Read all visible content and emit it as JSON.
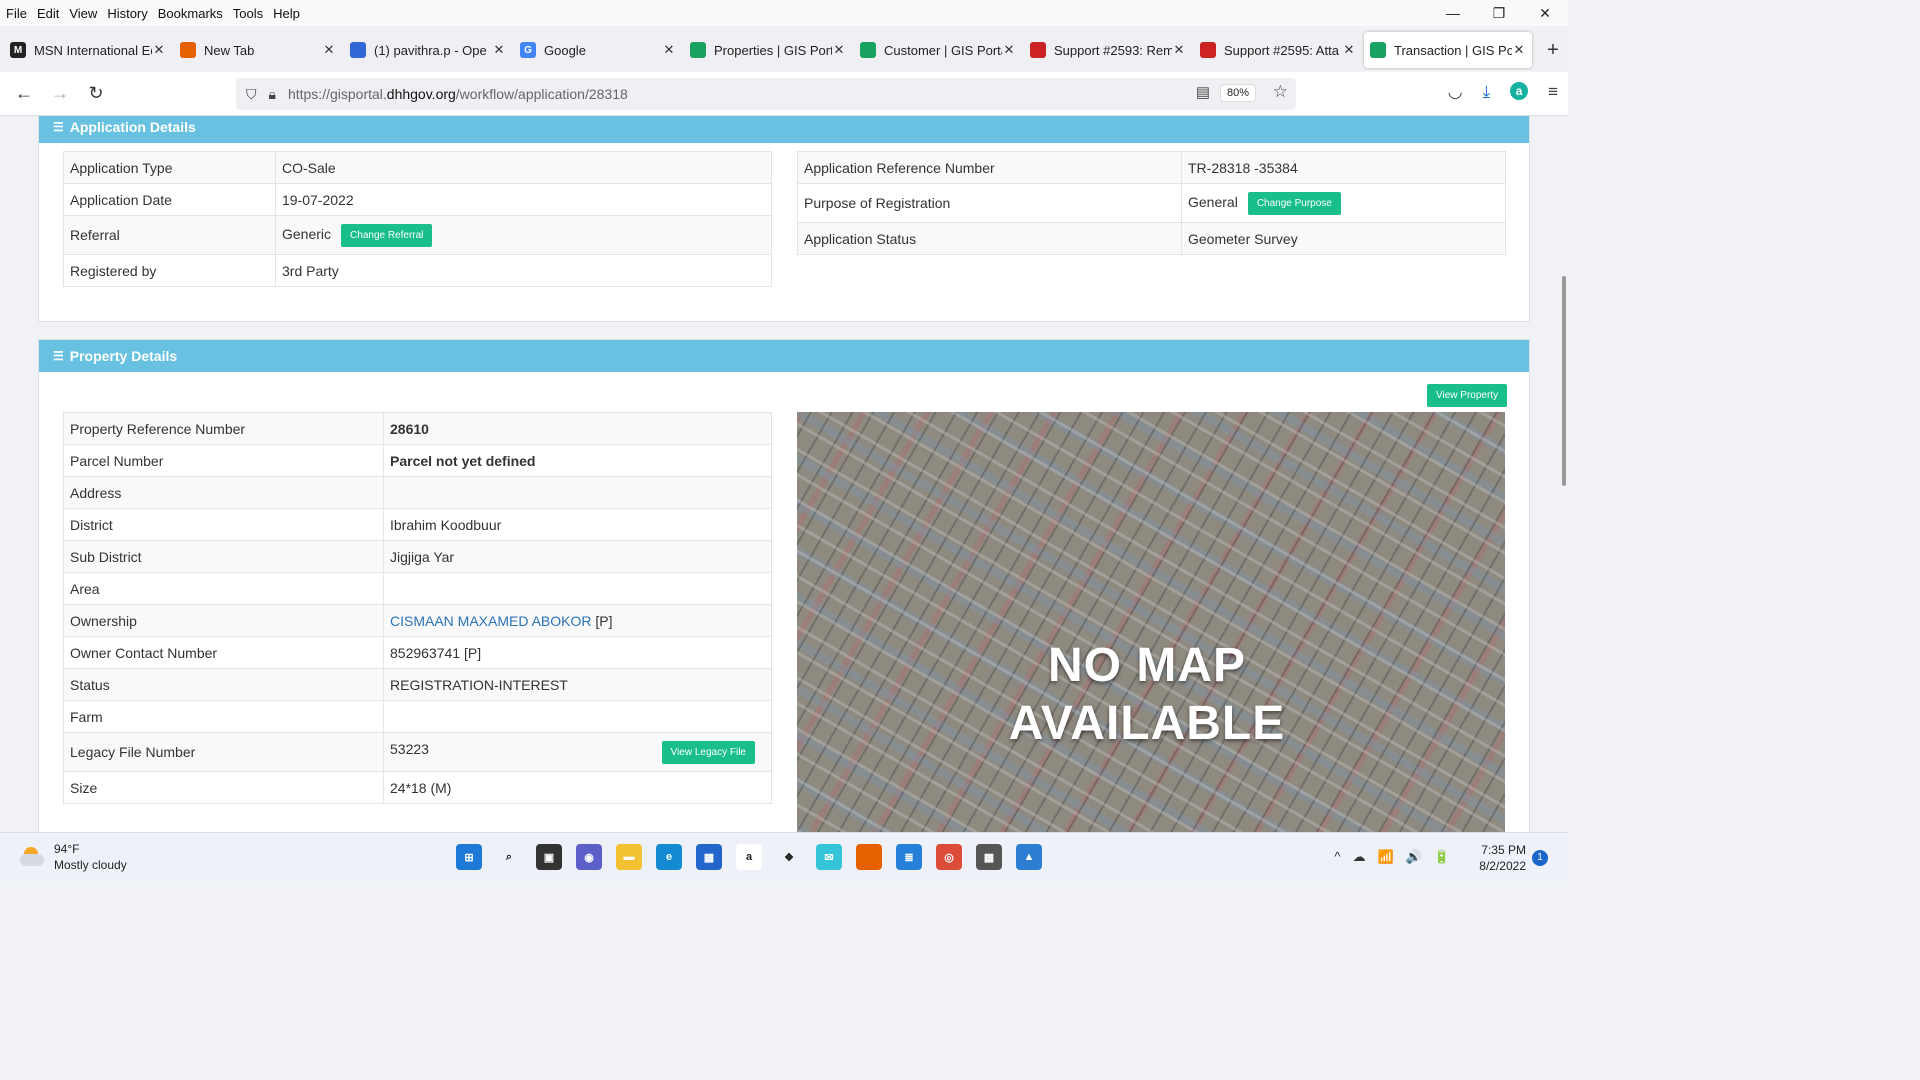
{
  "menu": [
    "File",
    "Edit",
    "View",
    "History",
    "Bookmarks",
    "Tools",
    "Help"
  ],
  "window_controls": {
    "minimize": "—",
    "restore": "❐",
    "close": "✕"
  },
  "tabs": [
    {
      "label": "MSN International Ed",
      "color": "#222222",
      "glyph": "M"
    },
    {
      "label": "New Tab",
      "color": "#e66000",
      "glyph": ""
    },
    {
      "label": "(1) pavithra.p - Ope",
      "color": "#3367d6",
      "glyph": ""
    },
    {
      "label": "Google",
      "color": "#4285f4",
      "glyph": "G"
    },
    {
      "label": "Properties | GIS Porta",
      "color": "#1aa260",
      "glyph": ""
    },
    {
      "label": "Customer | GIS Portal",
      "color": "#1aa260",
      "glyph": ""
    },
    {
      "label": "Support #2593: Rem",
      "color": "#cc2222",
      "glyph": ""
    },
    {
      "label": "Support #2595: Atta",
      "color": "#cc2222",
      "glyph": ""
    },
    {
      "label": "Transaction | GIS Por",
      "color": "#1aa260",
      "glyph": ""
    }
  ],
  "tab_close_glyph": "✕",
  "new_tab_glyph": "+",
  "nav": {
    "back": "←",
    "forward": "→",
    "reload": "↻",
    "url_prefix": "https://gisportal.",
    "url_domain": "dhhgov.org",
    "url_suffix": "/workflow/application/28318",
    "zoom": "80%",
    "star": "☆",
    "reader": "▤",
    "pocket": "◡",
    "download": "⤓",
    "account": "a",
    "menu": "≡"
  },
  "application_details": {
    "title": "Application Details",
    "header_icon": "☰",
    "left": {
      "application_type": {
        "label": "Application Type",
        "value": "CO-Sale"
      },
      "application_date": {
        "label": "Application Date",
        "value": "19-07-2022"
      },
      "referral": {
        "label": "Referral",
        "value": "Generic",
        "button": "Change Referral"
      },
      "registered_by": {
        "label": "Registered by",
        "value": "3rd Party"
      }
    },
    "right": {
      "reference_number": {
        "label": "Application Reference Number",
        "value": "TR-28318 -35384"
      },
      "purpose": {
        "label": "Purpose of Registration",
        "value": "General",
        "button": "Change Purpose"
      },
      "status": {
        "label": "Application Status",
        "value": "Geometer Survey"
      }
    }
  },
  "property_details": {
    "title": "Property Details",
    "header_icon": "☰",
    "view_property_button": "View Property",
    "property_reference_number": {
      "label": "Property Reference Number",
      "value": "28610"
    },
    "parcel_number": {
      "label": "Parcel Number",
      "value": "Parcel not yet defined"
    },
    "address": {
      "label": "Address",
      "value": ""
    },
    "district": {
      "label": "District",
      "value": "Ibrahim Koodbuur"
    },
    "sub_district": {
      "label": "Sub District",
      "value": "Jigjiga Yar"
    },
    "area": {
      "label": "Area",
      "value": ""
    },
    "ownership": {
      "label": "Ownership",
      "value": "CISMAAN MAXAMED ABOKOR",
      "suffix": " [P]"
    },
    "owner_contact": {
      "label": "Owner Contact Number",
      "value": "852963741 [P]"
    },
    "status": {
      "label": "Status",
      "value": "REGISTRATION-INTEREST"
    },
    "farm": {
      "label": "Farm",
      "value": ""
    },
    "legacy_file": {
      "label": "Legacy File Number",
      "value": "53223",
      "button": "View Legacy File"
    },
    "size": {
      "label": "Size",
      "value": "24*18 (M)"
    },
    "map_overlay_line1": "NO MAP",
    "map_overlay_line2": "AVAILABLE"
  },
  "taskbar": {
    "temperature": "94°F",
    "weather": "Mostly cloudy",
    "time": "7:35 PM",
    "date": "8/2/2022",
    "notifications": "1",
    "tray_icons": [
      "^",
      "☁",
      "📶",
      "🔊",
      "🔋"
    ],
    "apps": [
      {
        "name": "windows-start",
        "color": "#1e78d7",
        "glyph": "⊞"
      },
      {
        "name": "search",
        "color": "#eef1f7",
        "glyph": "⌕"
      },
      {
        "name": "task-view",
        "color": "#333333",
        "glyph": "▣"
      },
      {
        "name": "chat",
        "color": "#5b5fc7",
        "glyph": "◉"
      },
      {
        "name": "file-explorer",
        "color": "#f3c131",
        "glyph": "▬"
      },
      {
        "name": "edge",
        "color": "#138ad1",
        "glyph": "e"
      },
      {
        "name": "store",
        "color": "#2266cc",
        "glyph": "▦"
      },
      {
        "name": "amazon",
        "color": "#ffffff",
        "glyph": "a"
      },
      {
        "name": "dropbox",
        "color": "#eef1f7",
        "glyph": "❖"
      },
      {
        "name": "messenger",
        "color": "#36c5d8",
        "glyph": "✉"
      },
      {
        "name": "firefox",
        "color": "#e66000",
        "glyph": ""
      },
      {
        "name": "notepad",
        "color": "#2680d9",
        "glyph": "≣"
      },
      {
        "name": "chrome",
        "color": "#dd4b39",
        "glyph": "◎"
      },
      {
        "name": "calculator",
        "color": "#555555",
        "glyph": "▦"
      },
      {
        "name": "photos",
        "color": "#2d7dd2",
        "glyph": "▲"
      }
    ]
  }
}
